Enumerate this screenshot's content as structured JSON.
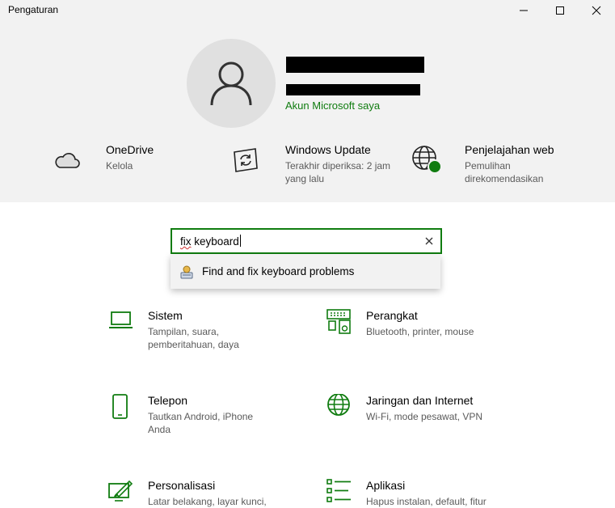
{
  "window": {
    "title": "Pengaturan"
  },
  "profile": {
    "ms_account_link": "Akun Microsoft saya"
  },
  "quick_links": [
    {
      "title": "OneDrive",
      "subtitle": "Kelola",
      "icon": "cloud-icon"
    },
    {
      "title": "Windows Update",
      "subtitle": "Terakhir diperiksa: 2 jam yang lalu",
      "icon": "sync-icon"
    },
    {
      "title": "Penjelajahan web",
      "subtitle": "Pemulihan direkomendasikan",
      "icon": "globe-icon"
    }
  ],
  "search": {
    "value_part1": "fix",
    "value_part2": " keyboard"
  },
  "suggestion": {
    "label": "Find and fix keyboard problems",
    "icon": "troubleshooter-icon"
  },
  "categories": [
    {
      "title": "Sistem",
      "subtitle": "Tampilan, suara, pemberitahuan, daya",
      "icon": "laptop-icon"
    },
    {
      "title": "Perangkat",
      "subtitle": "Bluetooth, printer, mouse",
      "icon": "devices-icon"
    },
    {
      "title": "Telepon",
      "subtitle": "Tautkan Android, iPhone Anda",
      "icon": "phone-icon"
    },
    {
      "title": "Jaringan dan Internet",
      "subtitle": "Wi-Fi, mode pesawat, VPN",
      "icon": "globe-icon"
    },
    {
      "title": "Personalisasi",
      "subtitle": "Latar belakang, layar kunci,",
      "icon": "personalization-icon"
    },
    {
      "title": "Aplikasi",
      "subtitle": "Hapus instalan, default, fitur",
      "icon": "apps-icon"
    }
  ],
  "colors": {
    "accent": "#107c10",
    "header_bg": "#f2f2f2",
    "status_dot": "#107c10"
  }
}
